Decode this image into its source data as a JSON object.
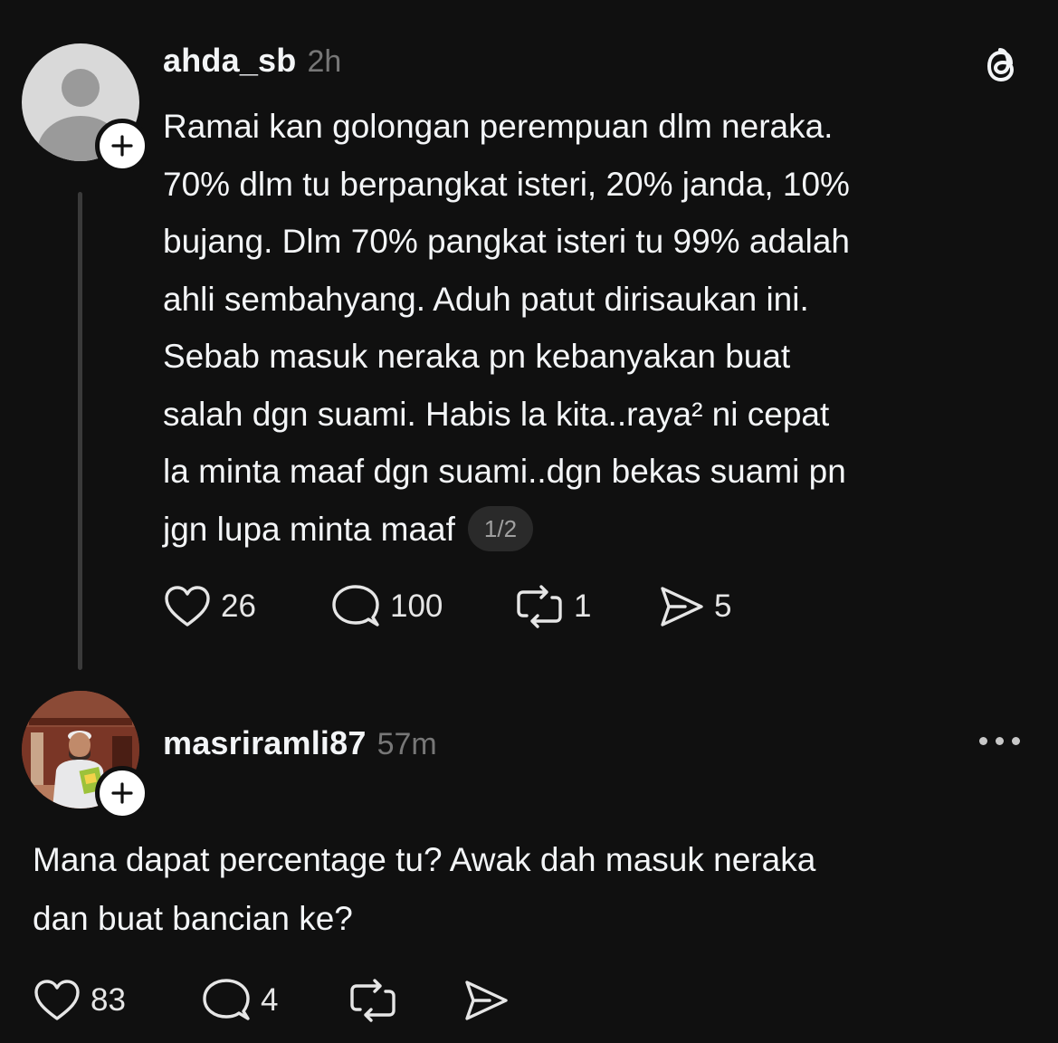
{
  "post1": {
    "username": "ahda_sb",
    "time": "2h",
    "lines": [
      "Ramai kan golongan perempuan dlm neraka.",
      "70% dlm tu berpangkat isteri, 20% janda, 10%",
      "bujang. Dlm 70% pangkat isteri tu 99% adalah",
      "ahli sembahyang. Aduh patut dirisaukan ini.",
      "Sebab masuk neraka pn kebanyakan buat",
      "salah dgn suami. Habis la kita..raya² ni cepat",
      "la minta maaf dgn suami..dgn bekas suami pn",
      "jgn lupa minta maaf"
    ],
    "page_indicator": "1/2",
    "likes": "26",
    "replies": "100",
    "reposts": "1",
    "shares": "5"
  },
  "post2": {
    "username": "masriramli87",
    "time": "57m",
    "lines": [
      "Mana dapat percentage tu? Awak dah masuk neraka",
      "dan buat bancian ke?"
    ],
    "likes": "83",
    "replies": "4"
  },
  "icons": {
    "logo": "threads-logo-icon",
    "follow": "plus-icon",
    "like": "heart-icon",
    "reply": "comment-icon",
    "repost": "repost-icon",
    "share": "send-icon",
    "more": "more-dots-icon"
  },
  "colors": {
    "background": "#101010",
    "text": "#f3f5f7",
    "muted": "#777777"
  }
}
